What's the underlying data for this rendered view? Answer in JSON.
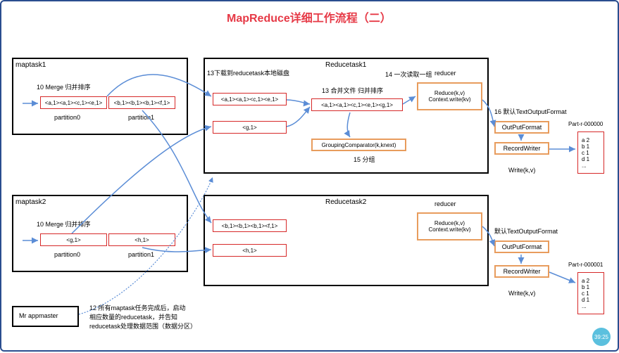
{
  "title": "MapReduce详细工作流程（二）",
  "maptask1": {
    "name": "maptask1",
    "merge_label": "10 Merge 归并排序",
    "part0": "<a,1><a,1><c,1><e,1>",
    "part1": "<b,1><b,1><b,1><f,1>",
    "p0_label": "partition0",
    "p1_label": "partition1"
  },
  "maptask2": {
    "name": "maptask2",
    "merge_label": "10 Merge 归并排序",
    "part0": "<g,1>",
    "part1": "<h,1>",
    "p0_label": "partition0",
    "p1_label": "partition1"
  },
  "reducetask1": {
    "name": "Reducetask1",
    "step13a": "13下载到reducetask本地磁盘",
    "box1": "<a,1><a,1><c,1><e,1>",
    "box2": "<g,1>",
    "step13b": "13 合并文件 归并排序",
    "merged": "<a,1><a,1><c,1><e,1><g,1>",
    "step14": "14 一次读取一组",
    "grouping": "GroupingComparator(k,knext)",
    "step15": "15 分组",
    "reducer_label": "reducer",
    "reduce_fn": "Reduce(k,v)\nContext.write(kv)",
    "step16": "16 默认TextOutputFormat",
    "outputformat": "OutPutFormat",
    "recordwriter": "RecordWriter",
    "write": "Write(k,v)",
    "part_file": "Part-r-000000",
    "output": "a 2\nb 1\nc 1\nd 1\n..."
  },
  "reducetask2": {
    "name": "Reducetask2",
    "box1": "<b,1><b,1><b,1><f,1>",
    "box2": "<h,1>",
    "reducer_label": "reducer",
    "reduce_fn": "Reduce(k,v)\nContext.write(kv)",
    "outfmt_label": "默认TextOutputFormat",
    "outputformat": "OutPutFormat",
    "recordwriter": "RecordWriter",
    "write": "Write(k,v)",
    "part_file": "Part-r-000001",
    "output": "a 2\nb 1\nc 1\nd 1\n..."
  },
  "appmaster": {
    "name": "Mr appmaster",
    "note": "12 所有maptask任务完成后，启动\n相应数量的reducetask，并告知\nreducetask处理数据范围（数据分区）"
  },
  "badge": "39:25"
}
